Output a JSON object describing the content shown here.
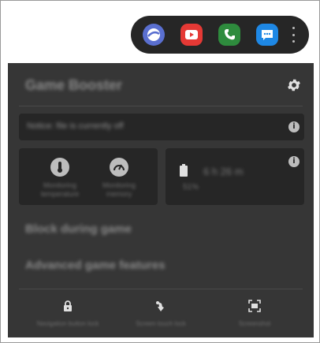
{
  "apps": [
    {
      "name": "browser",
      "icon": "browser-icon",
      "color": "#5a6fd0"
    },
    {
      "name": "youtube",
      "icon": "youtube-icon",
      "color": "#e53935"
    },
    {
      "name": "phone",
      "icon": "phone-icon",
      "color": "#2e8b3d"
    },
    {
      "name": "messages",
      "icon": "messages-icon",
      "color": "#1e88e5"
    }
  ],
  "panel": {
    "title": "Game Booster",
    "notice": "Notice: file is currently off",
    "monitor": {
      "temperature_label": "Monitoring temperature",
      "memory_label": "Monitoring memory"
    },
    "battery": {
      "time": "6 h 26 m",
      "label": "51%"
    },
    "menu": {
      "block": "Block during game",
      "advanced": "Advanced game features"
    },
    "bottom": [
      {
        "label": "Navigation button lock",
        "icon": "lock-icon"
      },
      {
        "label": "Screen touch lock",
        "icon": "touch-lock-icon"
      },
      {
        "label": "Screenshot",
        "icon": "screenshot-icon"
      }
    ]
  }
}
